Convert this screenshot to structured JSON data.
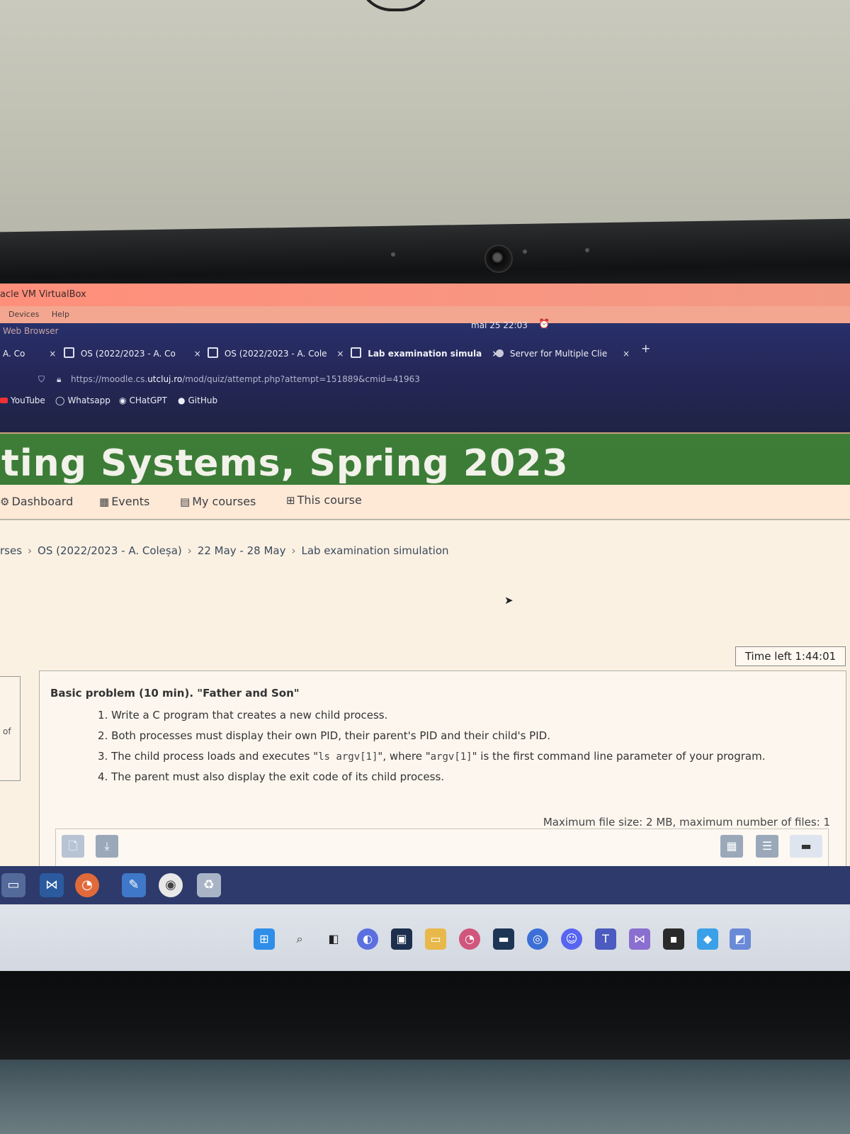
{
  "virtualbox": {
    "title": "acle VM VirtualBox",
    "menu": [
      "Devices",
      "Help"
    ],
    "app_label": "Web Browser"
  },
  "browser": {
    "clock": "mai 25  22:03",
    "tabs": [
      {
        "label": "A. Co"
      },
      {
        "label": "OS (2022/2023 - A. Co"
      },
      {
        "label": "OS (2022/2023 - A. Cole"
      },
      {
        "label": "Lab examination simula"
      },
      {
        "label": "Server for Multiple Clie"
      }
    ],
    "new_tab": "+",
    "close_glyph": "×",
    "url_prefix": "https://moodle.cs.",
    "url_domain": "utcluj.ro",
    "url_path": "/mod/quiz/attempt.php?attempt=151889&cmid=41963",
    "bookmarks": [
      "YouTube",
      "Whatsapp",
      "CHatGPT",
      "GitHub"
    ]
  },
  "course": {
    "title": "ting Systems, Spring 2023",
    "nav": [
      "Dashboard",
      "Events",
      "My courses",
      "This course"
    ],
    "breadcrumb": [
      "rses",
      "OS (2022/2023 - A. Coleșa)",
      "22 May - 28 May",
      "Lab examination simulation"
    ]
  },
  "quiz": {
    "time_left": "Time left 1:44:01",
    "left_block_text": "of",
    "question_title": "Basic problem (10 min). \"Father and Son\"",
    "items": [
      "1. Write a C program that creates a new child process.",
      "2. Both processes must display their own PID, their parent's PID and their child's PID.",
      "3. The child process loads and executes \"ls argv[1]\", where \"argv[1]\" is the first command line parameter of your program.",
      "4. The parent must also display the exit code of its child process."
    ],
    "item3_parts": {
      "pre": "3. The child process loads and executes \"",
      "code1": "ls argv[1]",
      "mid": "\", where \"",
      "code2": "argv[1]",
      "post": "\" is the first command line parameter of your program."
    },
    "file_info": "Maximum file size: 2 MB, maximum number of files: 1"
  },
  "icons": {
    "file_icons": [
      "new-file-icon",
      "download-icon"
    ],
    "view_icons": [
      "grid-view-icon",
      "list-view-icon",
      "folder-view-icon"
    ]
  },
  "colors": {
    "course_header": "#3b7c36",
    "browser_bar": "#25285a",
    "vbox_title": "#ff8f7b",
    "vm_taskbar": "#2d3a6b"
  }
}
